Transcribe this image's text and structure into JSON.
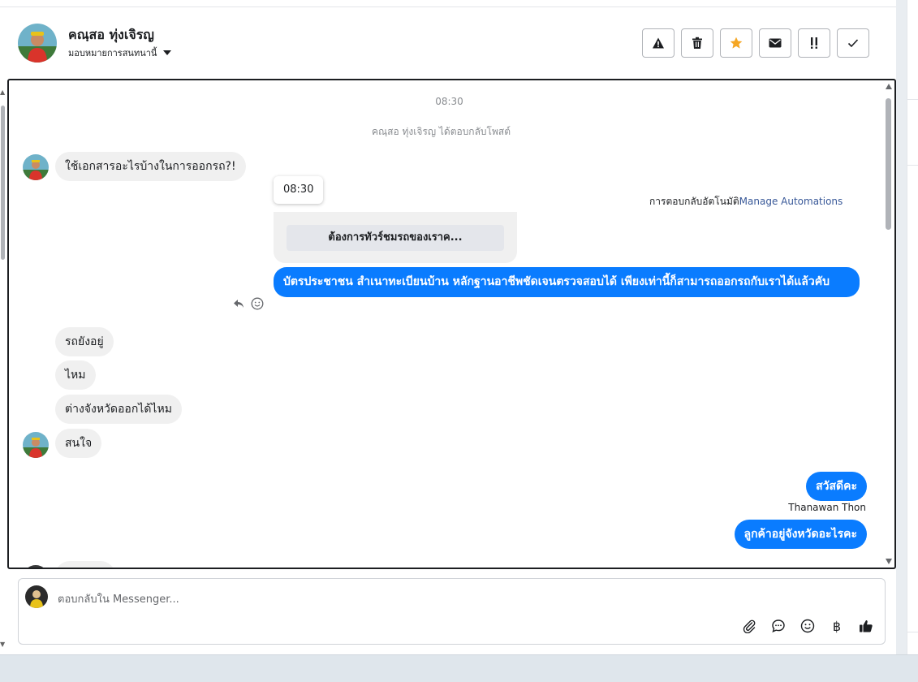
{
  "header": {
    "contact_name": "คณฺสอ ทุ่งเจิรญ",
    "assignment_label": "มอบหมายการสนทนานี้"
  },
  "actions": [
    {
      "icon": "warning-icon",
      "label": "Spam"
    },
    {
      "icon": "trash-icon",
      "label": "Delete"
    },
    {
      "icon": "star-icon",
      "label": "Star"
    },
    {
      "icon": "envelope-icon",
      "label": "Mark unread"
    },
    {
      "icon": "follow-up-icon",
      "label": "Follow up"
    },
    {
      "icon": "check-icon",
      "label": "Done"
    }
  ],
  "chat": {
    "timestamp": "08:30",
    "notice": "คณฺสอ ทุ่งเจิรญ ได้ตอบกลับโพสต์",
    "tooltip_time": "08:30",
    "automation_label": "การตอบกลับอัตโนมัติ",
    "automation_link": "Manage Automations",
    "card_button": "ต้องการทัวร์ชมรถของเราค...",
    "messages": {
      "in_1": "ใช้เอกสารอะไรบ้างในการออกรถ?!",
      "out_1": "บัตรประชาชน สำเนาทะเบียนบ้าน หลักฐานอาชีพชัดเจนตรวจสอบได้ เพียงเท่านี้ก็สามารถออกรถกับเราได้แล้วคับ",
      "in_2": "รถยังอยู่",
      "in_3": "ไหม",
      "in_4": "ต่างจังหวัดออกได้ไหม",
      "in_5": "สนใจ",
      "out_2": "สวัสดีคะ",
      "sender": "Thanawan Thon",
      "out_3": "ลูกค้าอยู่จังหวัดอะไรคะ"
    }
  },
  "composer": {
    "placeholder": "ตอบกลับใน Messenger..."
  },
  "colors": {
    "accent": "#0a7cff",
    "star": "#f5a623",
    "link": "#385898"
  }
}
